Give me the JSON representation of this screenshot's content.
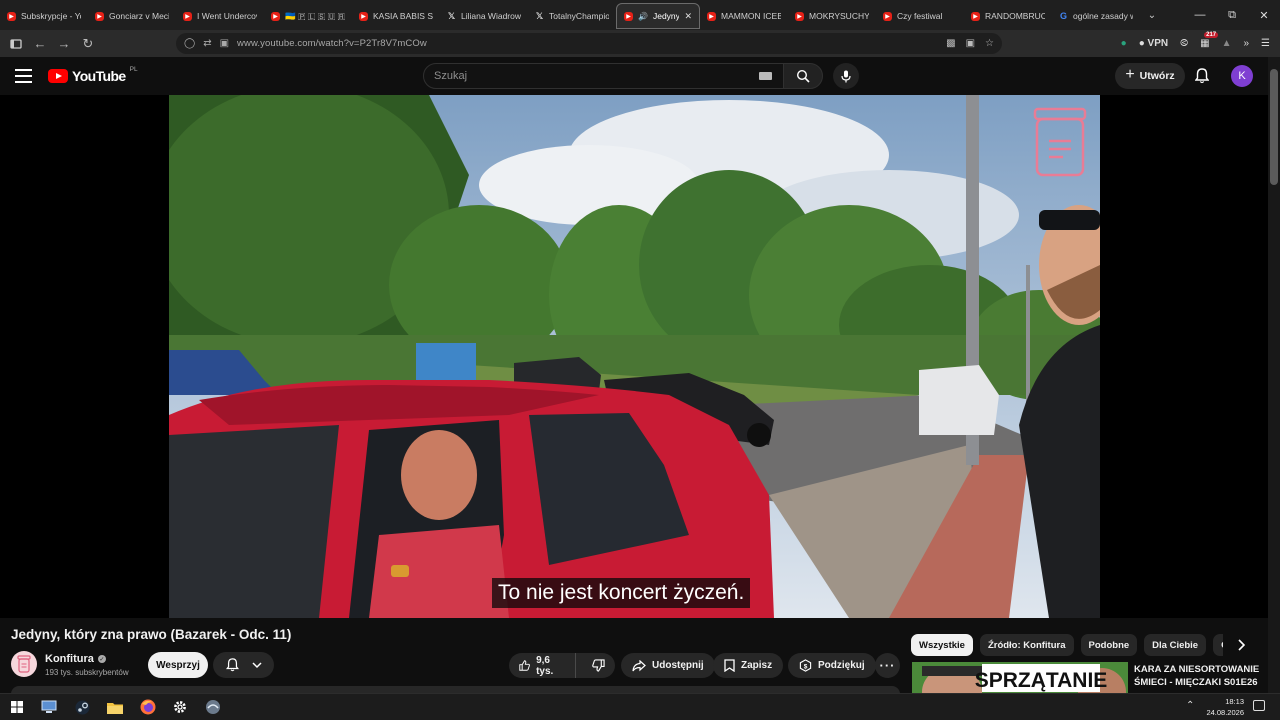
{
  "browser": {
    "tabs": [
      {
        "label": "Subskrypcje - Yo",
        "icon": "youtube"
      },
      {
        "label": "Gonciarz v Meci",
        "icon": "youtube"
      },
      {
        "label": "I Went Undercov",
        "icon": "youtube"
      },
      {
        "label": "🇺🇦 🇵 🇱 🇸 🇺 🇷",
        "icon": "youtube"
      },
      {
        "label": "KASIA BABIS SZC",
        "icon": "youtube"
      },
      {
        "label": "Liliana Wiadrowa",
        "icon": "x"
      },
      {
        "label": "TotalnyChampio",
        "icon": "x"
      },
      {
        "label": "Jedyny, kt",
        "icon": "youtube",
        "active": true
      },
      {
        "label": "MAMMON ICEBE",
        "icon": "youtube"
      },
      {
        "label": "MOKRYSUCHY",
        "icon": "youtube"
      },
      {
        "label": "Czy festiwal",
        "icon": "youtube"
      },
      {
        "label": "RANDOMBRUCE",
        "icon": "youtube"
      },
      {
        "label": "ogólne zasady w",
        "icon": "google"
      }
    ],
    "url": "www.youtube.com/watch?v=P2Tr8V7mCOw",
    "vpn_label": "VPN",
    "ext_badge": "217"
  },
  "youtube": {
    "logo_text": "YouTube",
    "country_code": "PL",
    "search_placeholder": "Szukaj",
    "create_label": "Utwórz",
    "avatar_letter": "K"
  },
  "video": {
    "subtitle": "To nie jest koncert życzeń.",
    "title": "Jedyny, który zna prawo (Bazarek - Odc. 11)",
    "channel_name": "Konfitura",
    "subscribers": "193 tys. subskrybentów",
    "support_label": "Wesprzyj",
    "like_count": "9,6 tys.",
    "share_label": "Udostępnij",
    "save_label": "Zapisz",
    "thanks_label": "Podziękuj"
  },
  "sidebar": {
    "chips": [
      "Wszystkie",
      "Źródło: Konfitura",
      "Podobne",
      "Dla Ciebie",
      "Ostatnio"
    ],
    "recommendation": {
      "title": "KARA ZA NIESORTOWANIE ŚMIECI - MIĘCZAKI S01E26",
      "thumb_text": "SPRZĄTANIE"
    }
  },
  "taskbar": {
    "time": "18:13",
    "date": "24.08.2026"
  },
  "colors": {
    "yt_red": "#ff0000",
    "bg": "#0f0f0f",
    "pill": "#272727",
    "avatar": "#7f3fd2"
  }
}
